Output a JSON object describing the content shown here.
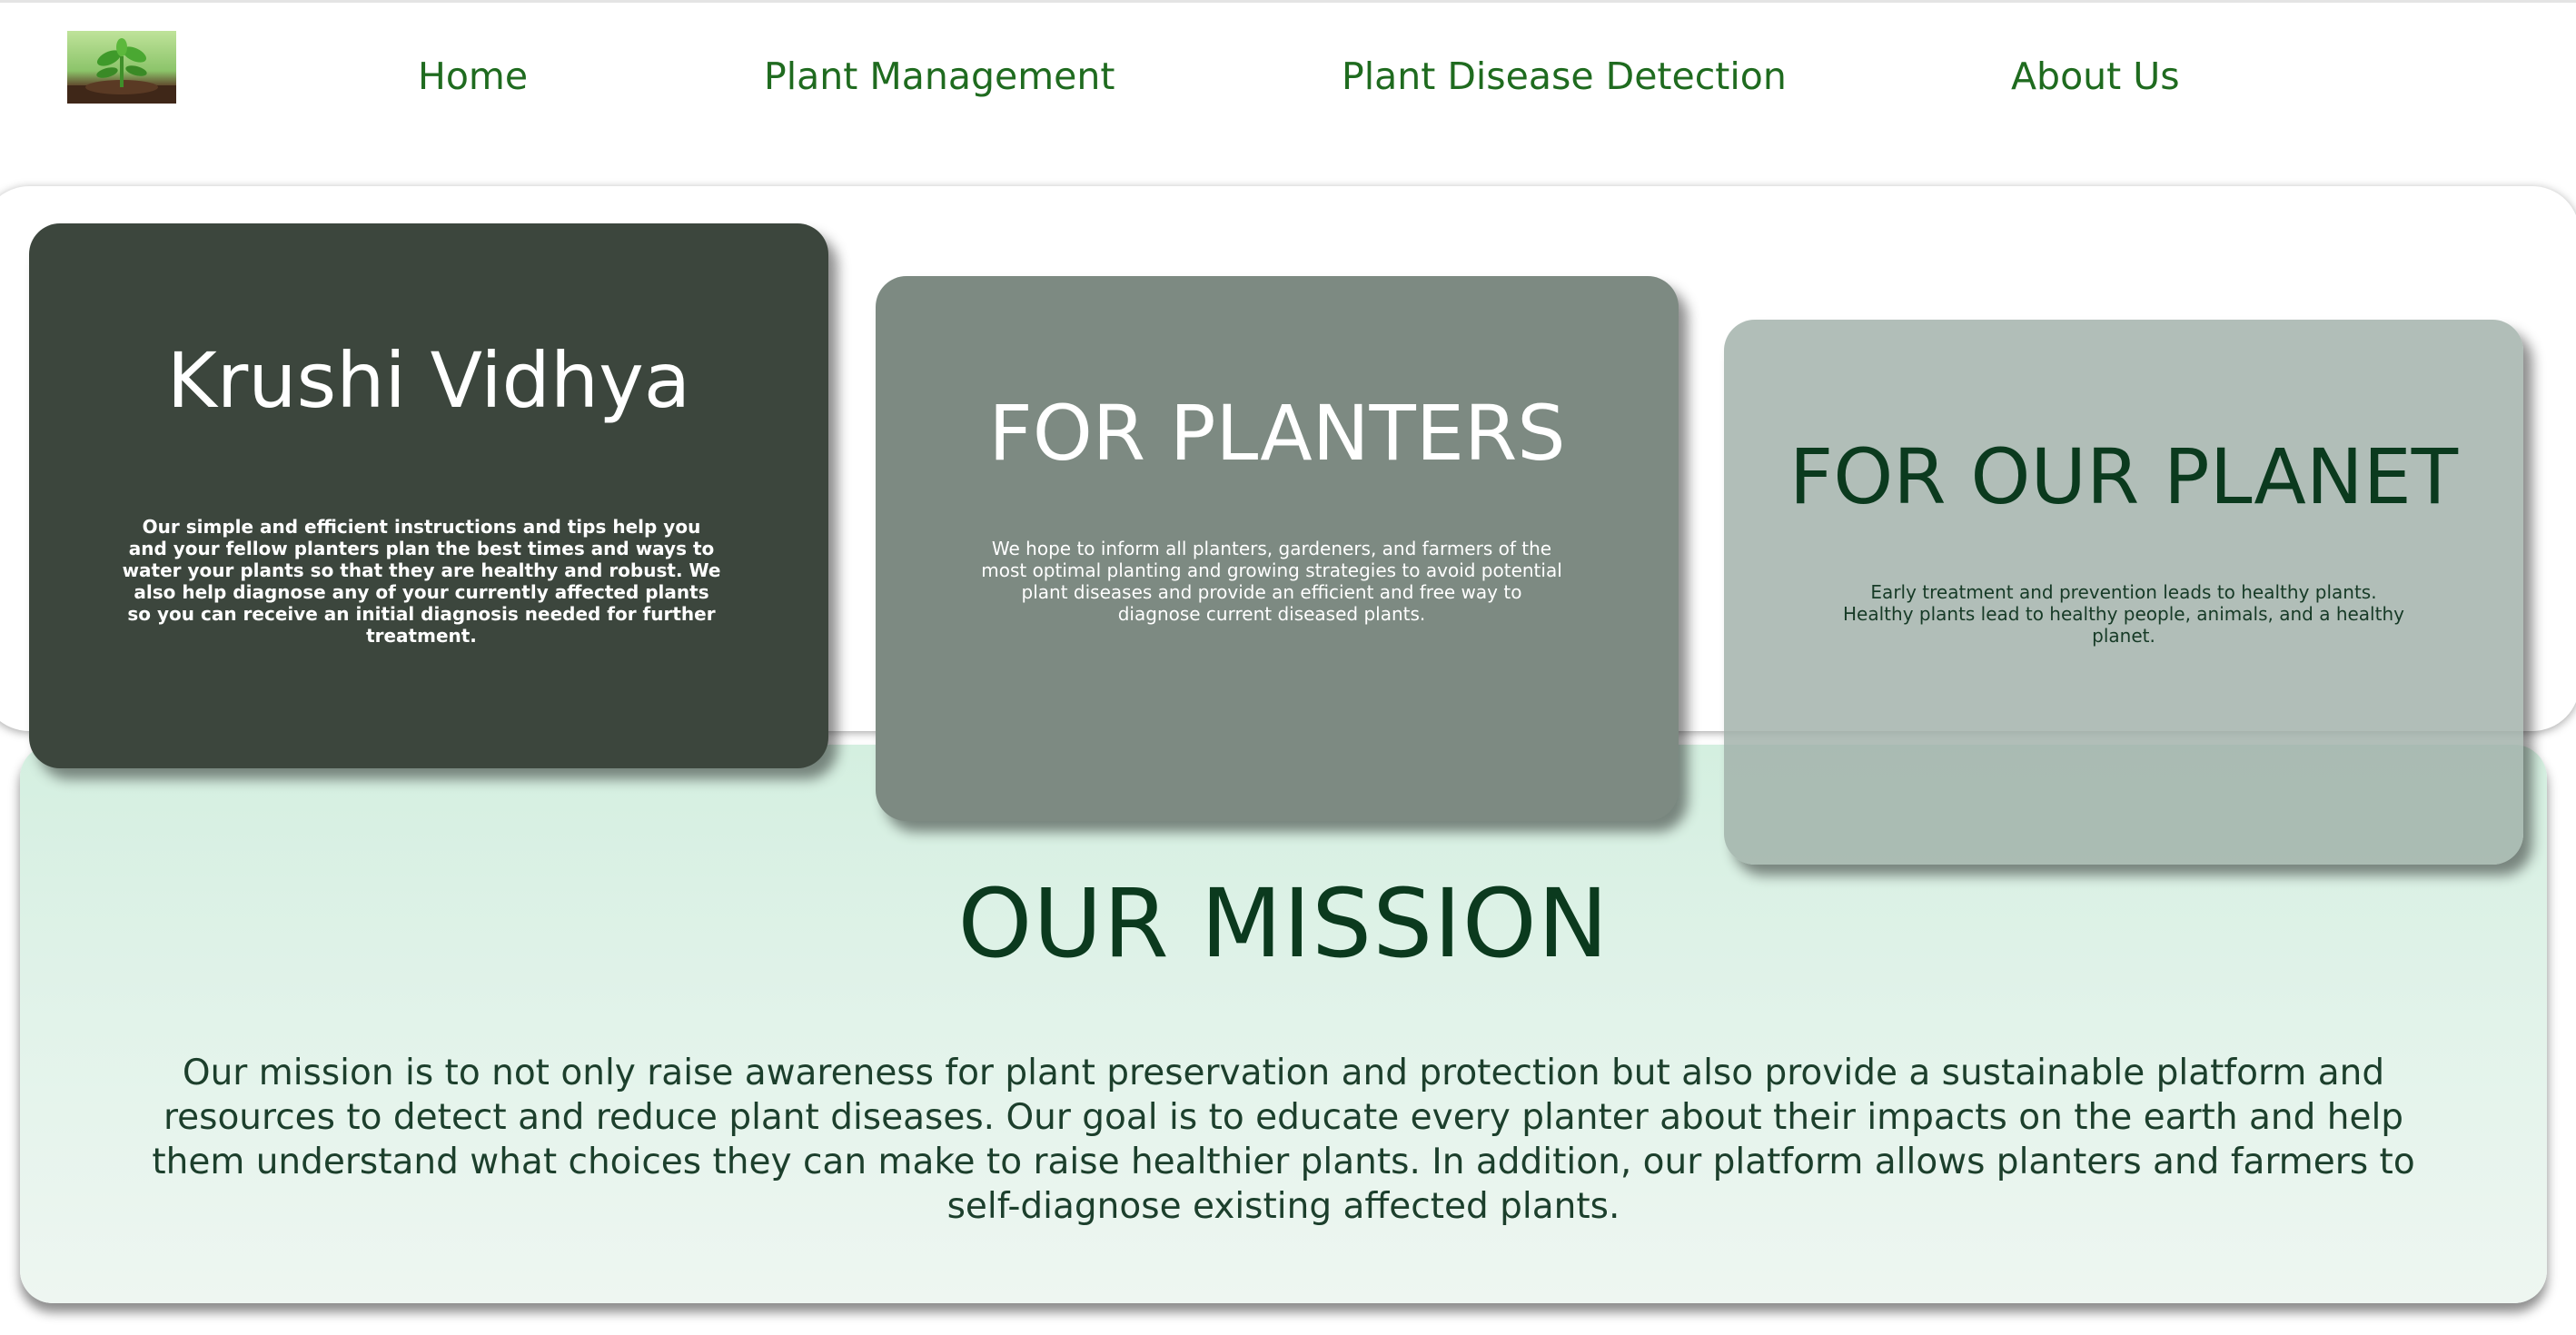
{
  "nav": {
    "logo_alt": "seedling-logo",
    "links": [
      {
        "label": "Home"
      },
      {
        "label": "Plant Management"
      },
      {
        "label": "Plant Disease Detection"
      },
      {
        "label": "About Us"
      }
    ]
  },
  "cards": [
    {
      "title": "Krushi Vidhya",
      "text": "Our simple and efficient instructions and tips help you and your fellow planters plan the best times and ways to water your plants so that they are healthy and robust. We also help diagnose any of your currently affected plants so you can receive an initial diagnosis needed for further treatment."
    },
    {
      "title": "FOR PLANTERS",
      "text": "We hope to inform all planters, gardeners, and farmers of the most optimal planting and growing strategies to avoid potential plant diseases and provide an efficient and free way to diagnose current diseased plants."
    },
    {
      "title": "FOR OUR PLANET",
      "text": "Early treatment and prevention leads to healthy plants. Healthy plants lead to healthy people, animals, and a healthy planet."
    }
  ],
  "mission": {
    "title": "OUR MISSION",
    "text": "Our mission is to not only raise awareness for plant preservation and protection but also provide a sustainable platform and resources to detect and reduce plant diseases. Our goal is to educate every planter about their impacts on the earth and help them understand what choices they can make to raise healthier plants. In addition, our platform allows planters and farmers to self-diagnose existing affected plants."
  },
  "colors": {
    "nav_link": "#1f6b1f",
    "dark_card": "#3c463d",
    "mid_card": "#7d8a82",
    "light_card": "#a0b0a8",
    "mission_title": "#0b3a1e"
  }
}
